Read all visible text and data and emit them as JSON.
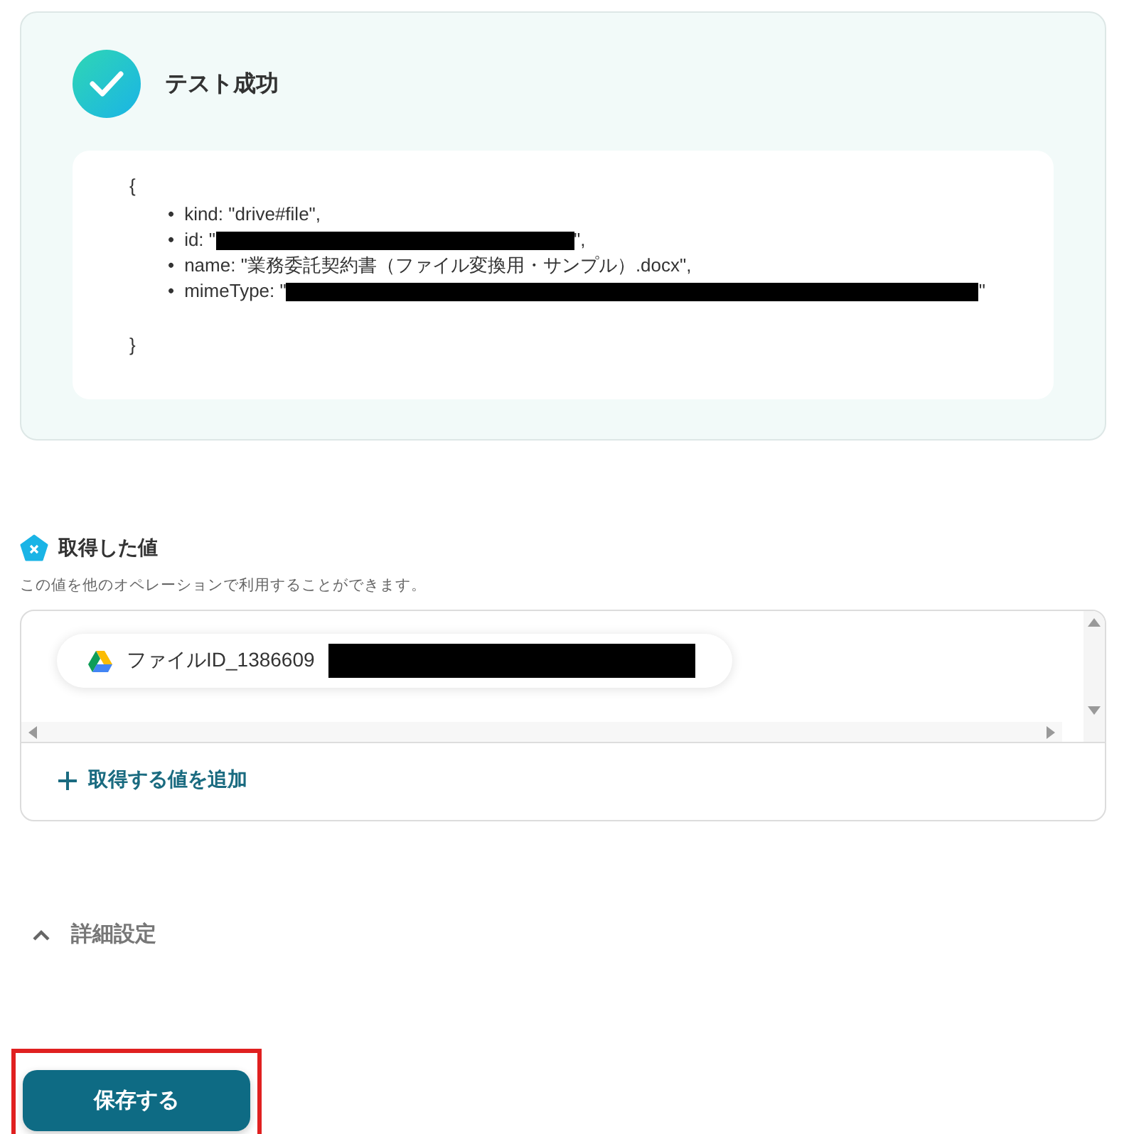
{
  "test_result": {
    "title": "テスト成功",
    "open_brace": "{",
    "close_brace": "}",
    "fields": [
      {
        "bullet": "•",
        "key": "kind:",
        "value": "\"drive#file\",",
        "kind": "plain"
      },
      {
        "bullet": "•",
        "key": "id:",
        "value": "\"",
        "after": "\",",
        "kind": "redacted"
      },
      {
        "bullet": "•",
        "key": "name:",
        "value": "\"業務委託契約書（ファイル変換用・サンプル）.docx\",",
        "kind": "plain"
      },
      {
        "bullet": "•",
        "key": "mimeType:",
        "value": "\"",
        "after": "\"",
        "kind": "redacted"
      }
    ]
  },
  "obtained_values": {
    "title": "取得した値",
    "description": "この値を他のオペレーションで利用することができます。",
    "values": [
      {
        "label": "ファイルID_1386609",
        "redacted": true
      }
    ],
    "add_link": "取得する値を追加"
  },
  "advanced": {
    "label": "詳細設定",
    "expanded": true
  },
  "save_button": {
    "label": "保存する",
    "highlighted": true
  }
}
